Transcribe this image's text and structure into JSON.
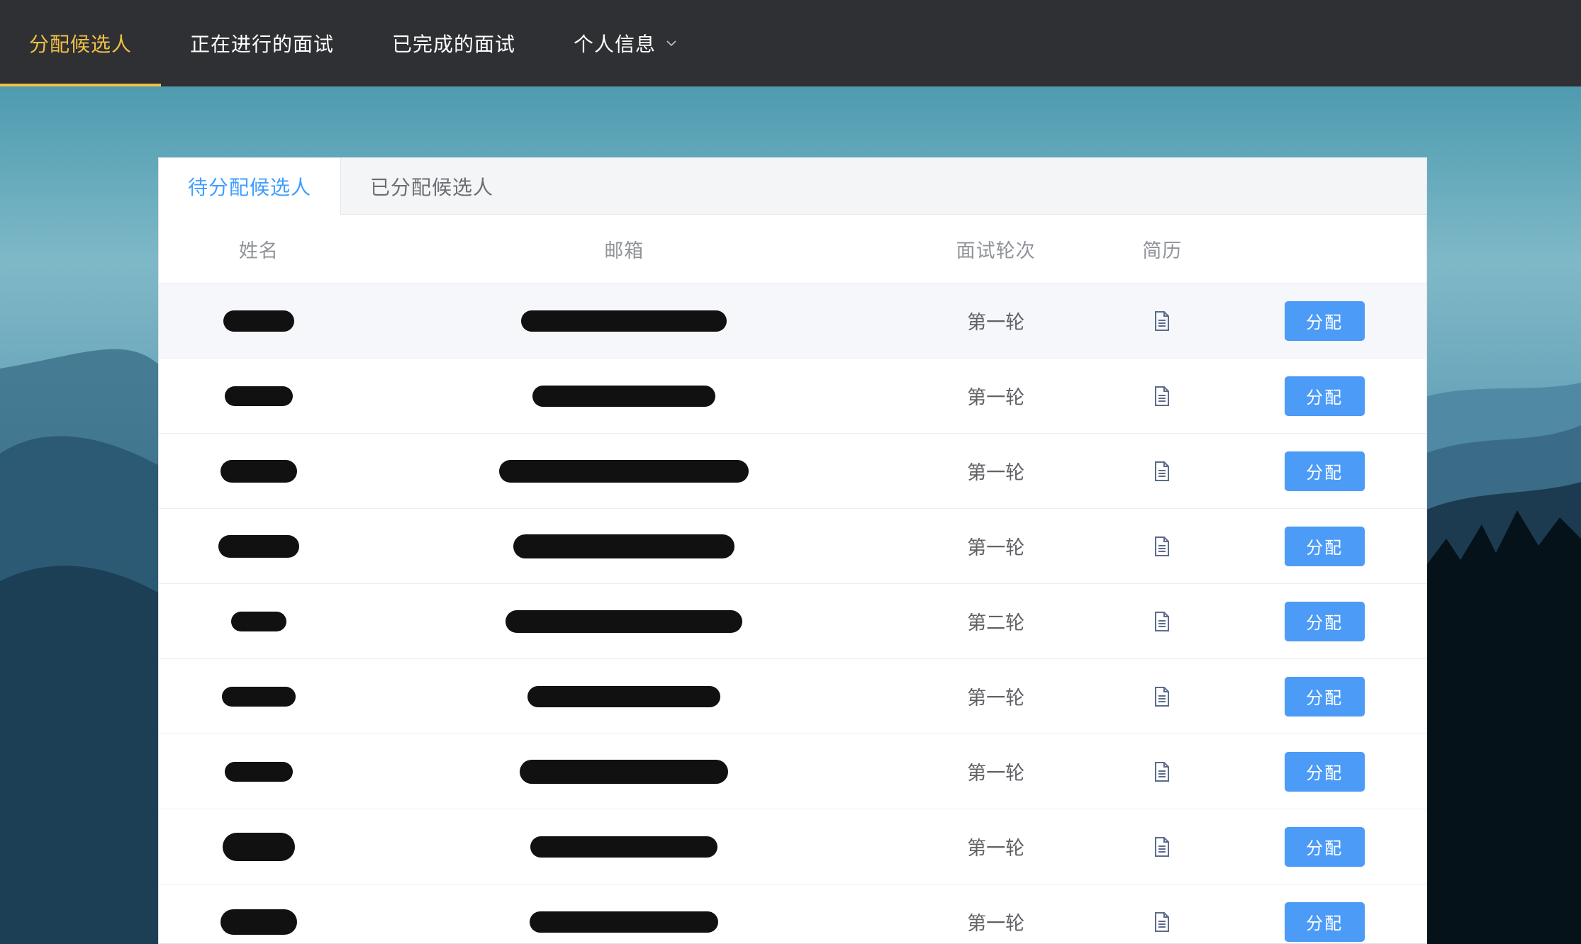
{
  "nav": {
    "items": [
      {
        "label": "分配候选人",
        "active": true
      },
      {
        "label": "正在进行的面试",
        "active": false
      },
      {
        "label": "已完成的面试",
        "active": false
      },
      {
        "label": "个人信息",
        "active": false,
        "dropdown": true
      }
    ]
  },
  "tabs": [
    {
      "label": "待分配候选人",
      "active": true
    },
    {
      "label": "已分配候选人",
      "active": false
    }
  ],
  "table": {
    "columns": [
      "姓名",
      "邮箱",
      "面试轮次",
      "简历",
      ""
    ],
    "rows": [
      {
        "name": "[redacted]",
        "email": "[redacted]",
        "round": "第一轮",
        "action": "分配"
      },
      {
        "name": "[redacted]",
        "email": "[redacted]",
        "round": "第一轮",
        "action": "分配"
      },
      {
        "name": "[redacted]",
        "email": "[redacted]",
        "round": "第一轮",
        "action": "分配"
      },
      {
        "name": "[redacted]",
        "email": "[redacted]",
        "round": "第一轮",
        "action": "分配"
      },
      {
        "name": "[redacted]",
        "email": "[redacted]",
        "round": "第二轮",
        "action": "分配"
      },
      {
        "name": "[redacted]",
        "email": "[redacted]",
        "round": "第一轮",
        "action": "分配"
      },
      {
        "name": "[redacted]",
        "email": "[redacted]",
        "round": "第一轮",
        "action": "分配"
      },
      {
        "name": "[redacted]",
        "email": "[redacted]",
        "round": "第一轮",
        "action": "分配"
      },
      {
        "name": "[redacted]",
        "email": "[redacted]",
        "round": "第一轮",
        "action": "分配"
      }
    ]
  },
  "icons": {
    "resume": "document-icon",
    "dropdown": "chevron-down-icon"
  },
  "colors": {
    "nav_bg": "#2f3033",
    "nav_active": "#f0c046",
    "primary": "#409eff",
    "button": "#4c9bf7"
  }
}
